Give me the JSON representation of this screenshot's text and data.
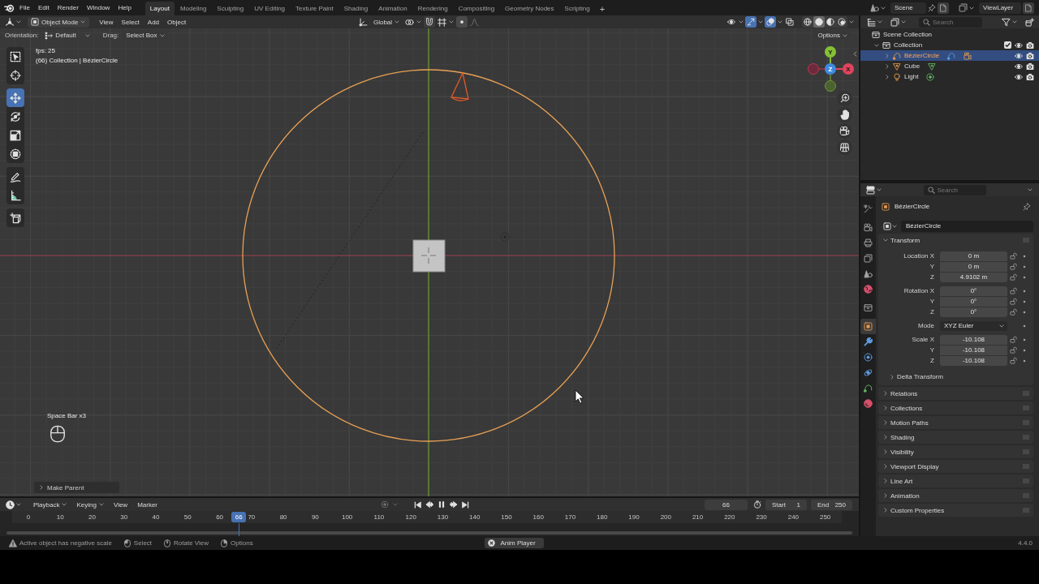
{
  "top_bar": {
    "menus": [
      "File",
      "Edit",
      "Render",
      "Window",
      "Help"
    ],
    "workspaces": [
      {
        "label": "Layout",
        "selected": true
      },
      {
        "label": "Modeling",
        "selected": false
      },
      {
        "label": "Sculpting",
        "selected": false
      },
      {
        "label": "UV Editing",
        "selected": false
      },
      {
        "label": "Texture Paint",
        "selected": false
      },
      {
        "label": "Shading",
        "selected": false
      },
      {
        "label": "Animation",
        "selected": false
      },
      {
        "label": "Rendering",
        "selected": false
      },
      {
        "label": "Compositing",
        "selected": false
      },
      {
        "label": "Geometry Nodes",
        "selected": false
      },
      {
        "label": "Scripting",
        "selected": false
      }
    ],
    "add_workspace": "+",
    "scene": "Scene",
    "view_layer": "ViewLayer"
  },
  "viewport": {
    "header": {
      "mode": "Object Mode",
      "menus": [
        "View",
        "Select",
        "Add",
        "Object"
      ],
      "orientation": "Global",
      "toggles": [
        {
          "kind": "visibility",
          "on": false
        },
        {
          "kind": "gizmos",
          "on": true
        },
        {
          "kind": "overlays",
          "on": true
        },
        {
          "kind": "xray",
          "on": false
        }
      ],
      "shading": [
        {
          "kind": "wireframe",
          "selected": false
        },
        {
          "kind": "solid",
          "selected": true
        },
        {
          "kind": "material",
          "selected": false
        },
        {
          "kind": "rendered",
          "selected": false
        }
      ]
    },
    "tool_settings": {
      "orientation_label": "Orientation:",
      "orientation": "Default",
      "drag_label": "Drag:",
      "drag": "Select Box",
      "options": "Options"
    },
    "info": [
      "fps: 25",
      "(66) Collection | BézierCircle"
    ],
    "tool_groups": [
      {
        "tools": [
          {
            "kind": "select_box",
            "selected": false
          },
          {
            "kind": "cursor",
            "selected": false
          }
        ]
      },
      {
        "tools": [
          {
            "kind": "move",
            "selected": true
          },
          {
            "kind": "rotate",
            "selected": false
          },
          {
            "kind": "scale",
            "selected": false
          },
          {
            "kind": "transform",
            "selected": false
          }
        ]
      },
      {
        "tools": [
          {
            "kind": "annotate",
            "selected": false
          },
          {
            "kind": "measure",
            "selected": false
          }
        ]
      },
      {
        "tools": [
          {
            "kind": "add_cube",
            "selected": false
          }
        ]
      }
    ],
    "gizmo": {
      "y": "Y",
      "z": "Z",
      "x": "X"
    },
    "key_hint": "Space Bar x3",
    "last_operator": {
      "title": "Make Parent",
      "expanded": false
    }
  },
  "timeline": {
    "menus": [
      {
        "label": "Playback",
        "kind": "dropdown"
      },
      {
        "label": "Keying",
        "kind": "dropdown"
      },
      {
        "label": "View",
        "kind": "menu"
      },
      {
        "label": "Marker",
        "kind": "menu"
      }
    ],
    "current_frame": "66",
    "start_label": "Start",
    "start": "1",
    "end_label": "End",
    "end": "250",
    "ruler": [
      "0",
      "10",
      "20",
      "30",
      "40",
      "50",
      "60",
      "70",
      "80",
      "90",
      "100",
      "110",
      "120",
      "130",
      "140",
      "150",
      "160",
      "170",
      "180",
      "190",
      "200",
      "210",
      "220",
      "230",
      "240",
      "250"
    ],
    "playhead": {
      "label": "66",
      "level": 0.264
    }
  },
  "outliner": {
    "search_placeholder": "Search",
    "tree": [
      {
        "label": "Scene Collection",
        "kind": "scene_collection",
        "selected": false,
        "children": [
          {
            "label": "Collection",
            "kind": "collection",
            "expanded": true,
            "checked": true,
            "selected": false,
            "children": [
              {
                "label": "BézierCircle",
                "kind": "curve",
                "expanded": false,
                "selected": true,
                "badges": [
                  {
                    "kind": "curve_data"
                  },
                  {
                    "kind": "camera"
                  }
                ]
              },
              {
                "label": "Cube",
                "kind": "mesh",
                "expanded": false,
                "selected": false,
                "badges": [
                  {
                    "kind": "mesh_data"
                  }
                ]
              },
              {
                "label": "Light",
                "kind": "light",
                "expanded": false,
                "selected": false,
                "badges": [
                  {
                    "kind": "light_data"
                  }
                ]
              }
            ]
          }
        ]
      }
    ]
  },
  "properties": {
    "search_placeholder": "Search",
    "tab_groups": [
      {
        "tabs": [
          {
            "kind": "tool",
            "selected": false
          }
        ]
      },
      {
        "tabs": [
          {
            "kind": "render",
            "selected": false
          },
          {
            "kind": "output",
            "selected": false
          },
          {
            "kind": "view_layer",
            "selected": false
          },
          {
            "kind": "scene",
            "selected": false
          },
          {
            "kind": "world",
            "selected": false
          }
        ]
      },
      {
        "tabs": [
          {
            "kind": "collection",
            "selected": false
          }
        ]
      },
      {
        "tabs": [
          {
            "kind": "object",
            "selected": true
          },
          {
            "kind": "modifiers",
            "selected": false
          },
          {
            "kind": "particles",
            "selected": false
          },
          {
            "kind": "physics",
            "selected": false
          },
          {
            "kind": "data",
            "selected": false
          },
          {
            "kind": "material",
            "selected": false
          }
        ]
      }
    ],
    "object_name": "BézierCircle",
    "datablock": "BézierCircle",
    "panels": [
      {
        "title": "Transform",
        "expanded": true,
        "groups": [
          {
            "fields": [
              {
                "label": "Location X",
                "value": "0 m",
                "kind": "number"
              },
              {
                "label": "Y",
                "value": "0 m",
                "kind": "number"
              },
              {
                "label": "Z",
                "value": "4.9102 m",
                "kind": "number"
              }
            ]
          },
          {
            "fields": [
              {
                "label": "Rotation X",
                "value": "0°",
                "kind": "number"
              },
              {
                "label": "Y",
                "value": "0°",
                "kind": "number"
              },
              {
                "label": "Z",
                "value": "0°",
                "kind": "number"
              }
            ]
          },
          {
            "fields": [
              {
                "label": "Mode",
                "value": "XYZ Euler",
                "kind": "dropdown"
              }
            ]
          },
          {
            "fields": [
              {
                "label": "Scale X",
                "value": "-10.108",
                "kind": "number"
              },
              {
                "label": "Y",
                "value": "-10.108",
                "kind": "number"
              },
              {
                "label": "Z",
                "value": "-10.108",
                "kind": "number"
              }
            ]
          }
        ],
        "subpanels": [
          {
            "title": "Delta Transform",
            "expanded": false
          }
        ]
      },
      {
        "title": "Relations",
        "expanded": false
      },
      {
        "title": "Collections",
        "expanded": false
      },
      {
        "title": "Motion Paths",
        "expanded": false
      },
      {
        "title": "Shading",
        "expanded": false
      },
      {
        "title": "Visibility",
        "expanded": false
      },
      {
        "title": "Viewport Display",
        "expanded": false
      },
      {
        "title": "Line Art",
        "expanded": false
      },
      {
        "title": "Animation",
        "expanded": false
      },
      {
        "title": "Custom Properties",
        "expanded": false
      }
    ]
  },
  "status_bar": {
    "message": "Active object has negative scale",
    "hints": [
      {
        "label": "Select",
        "kind": "left_mouse"
      },
      {
        "label": "Rotate View",
        "kind": "middle_mouse"
      },
      {
        "label": "Options",
        "kind": "right_mouse"
      }
    ],
    "player": "Anim Player",
    "version": "4.4.0"
  }
}
